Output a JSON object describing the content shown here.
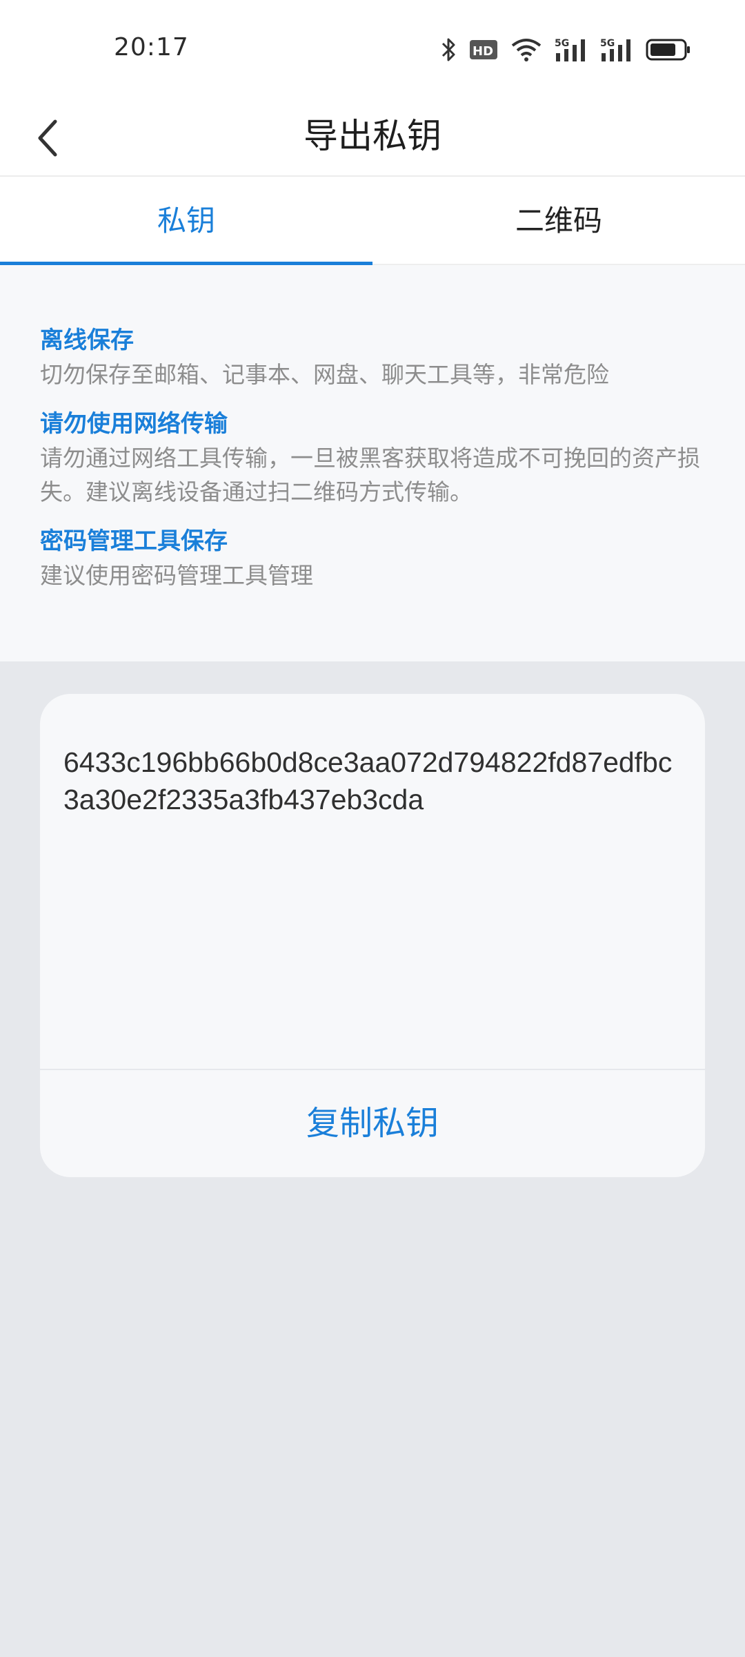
{
  "status_bar": {
    "time": "20:17",
    "icons": [
      "bluetooth-icon",
      "hd-icon",
      "wifi-icon",
      "signal-5g-icon",
      "signal-5g-icon",
      "battery-icon"
    ],
    "hd_label": "HD",
    "network_label": "5G"
  },
  "header": {
    "title": "导出私钥",
    "back_icon": "chevron-left-icon"
  },
  "tabs": [
    {
      "label": "私钥",
      "active": true
    },
    {
      "label": "二维码",
      "active": false
    }
  ],
  "tips": [
    {
      "title": "离线保存",
      "desc": "切勿保存至邮箱、记事本、网盘、聊天工具等，非常危险"
    },
    {
      "title": "请勿使用网络传输",
      "desc": "请勿通过网络工具传输，一旦被黑客获取将造成不可挽回的资产损失。建议离线设备通过扫二维码方式传输。"
    },
    {
      "title": "密码管理工具保存",
      "desc": "建议使用密码管理工具管理"
    }
  ],
  "key_card": {
    "private_key": "6433c196bb66b0d8ce3aa072d794822fd87edfbc3a30e2f2335a3fb437eb3cda",
    "copy_label": "复制私钥"
  },
  "colors": {
    "accent": "#1a7fd9",
    "page_bg": "#e6e8ec",
    "panel_bg": "#f7f8fa",
    "muted_text": "#8d8d8d"
  }
}
